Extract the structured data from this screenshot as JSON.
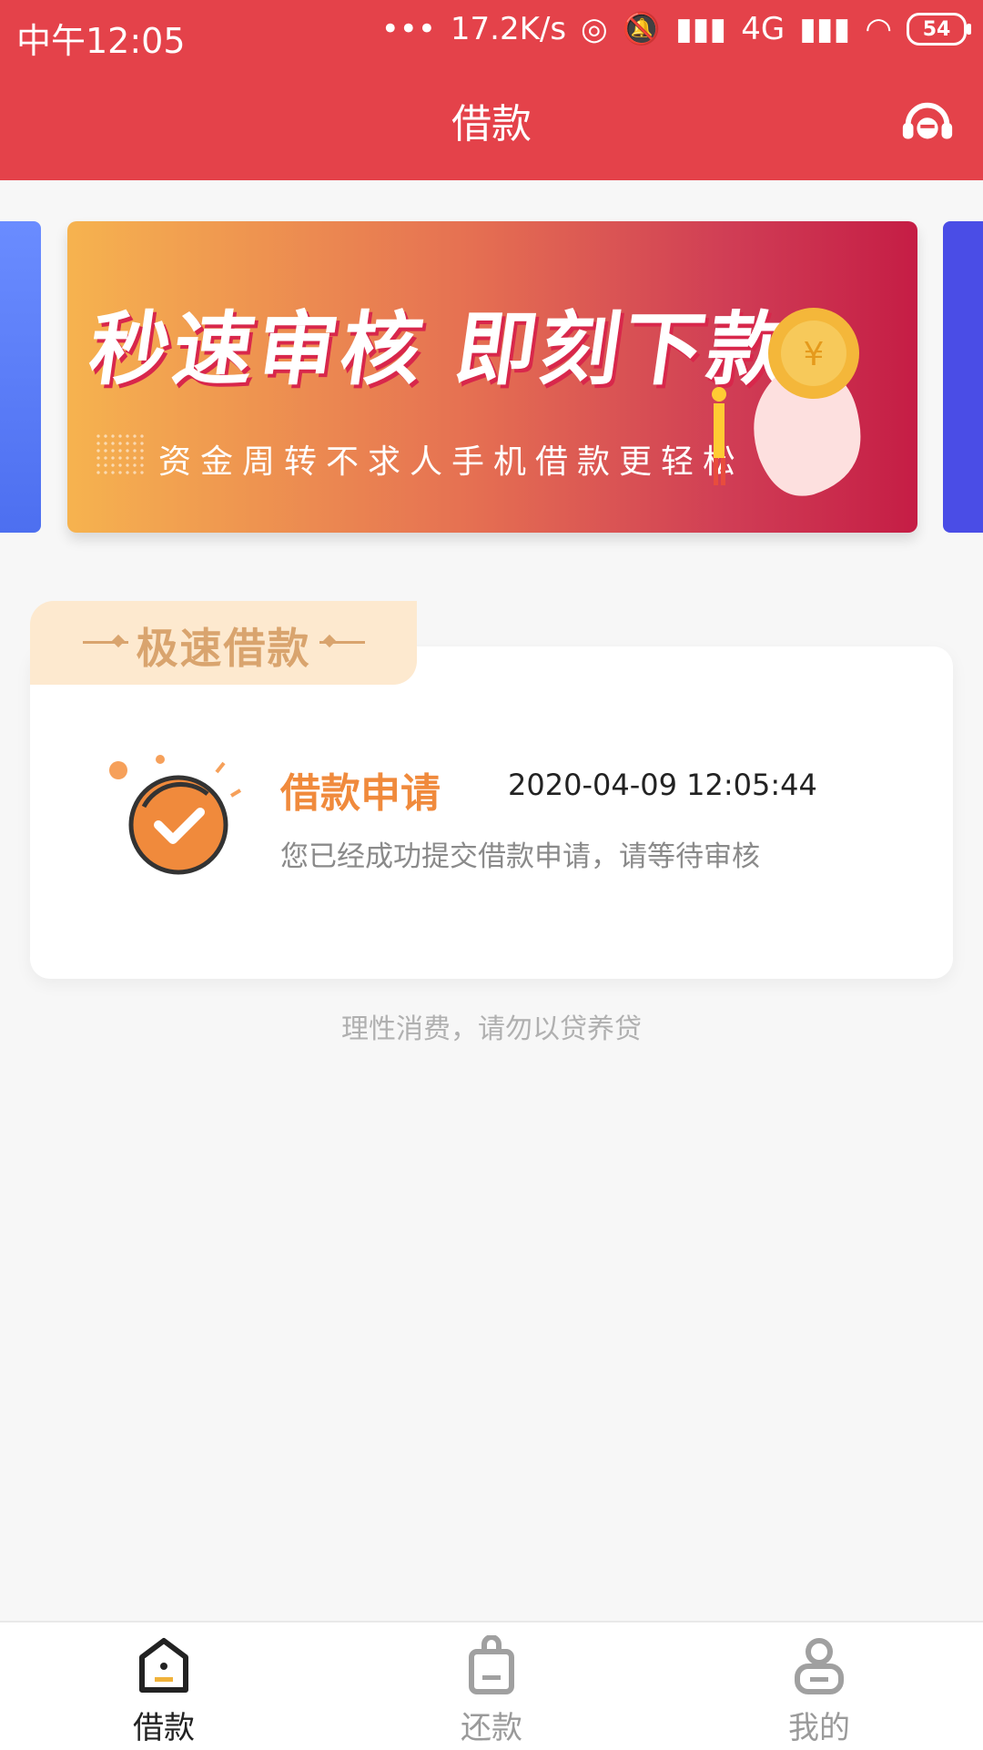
{
  "status_bar": {
    "time": "中午12:05",
    "network_speed": "17.2K/s",
    "network_type": "4G",
    "battery_level": "54"
  },
  "header": {
    "title": "借款",
    "support_icon": "customer-service-headset-icon"
  },
  "banner": {
    "headline": "秒速审核 即刻下款",
    "subline": "资金周转不求人手机借款更轻松"
  },
  "loan_card": {
    "section_title": "极速借款",
    "status_title": "借款申请",
    "timestamp": "2020-04-09 12:05:44",
    "message": "您已经成功提交借款申请，请等待审核",
    "icon": "check-circle-icon"
  },
  "disclaimer": "理性消费，请勿以贷养贷",
  "tab_bar": {
    "items": [
      {
        "label": "借款",
        "icon": "home-icon",
        "active": true
      },
      {
        "label": "还款",
        "icon": "bag-icon",
        "active": false
      },
      {
        "label": "我的",
        "icon": "user-icon",
        "active": false
      }
    ]
  },
  "colors": {
    "primary": "#e4424a",
    "accent_orange": "#f08a3c",
    "tab_gold": "#d9a46e"
  }
}
